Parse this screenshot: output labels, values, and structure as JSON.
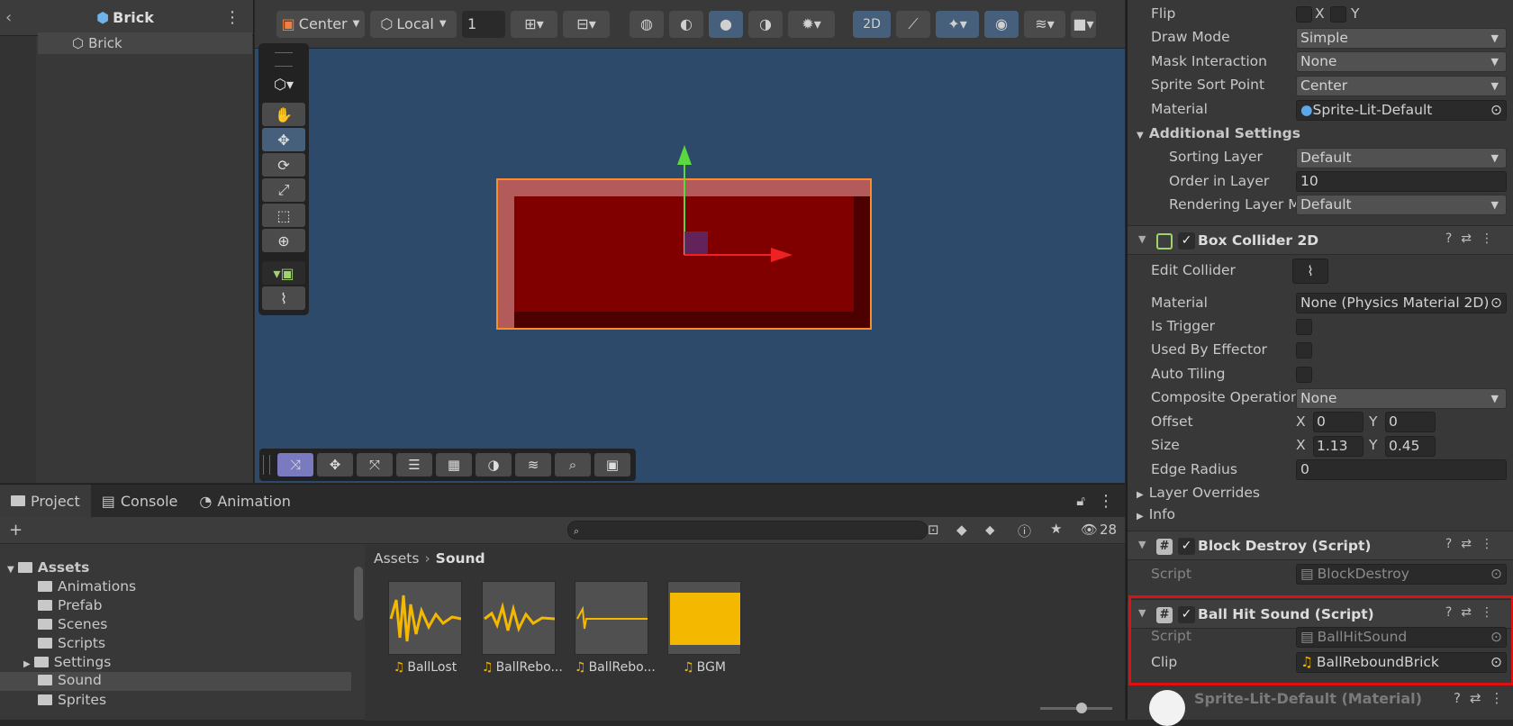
{
  "hierarchy": {
    "title": "Brick",
    "items": [
      {
        "label": "Brick"
      }
    ]
  },
  "scene_toolbar": {
    "pivot": "Center",
    "space": "Local",
    "grid_value": "1",
    "mode_2d": "2D"
  },
  "inspector": {
    "sprite": {
      "flip_label": "Flip",
      "flip_x": "X",
      "flip_y": "Y",
      "draw_mode_label": "Draw Mode",
      "draw_mode": "Simple",
      "mask_label": "Mask Interaction",
      "mask": "None",
      "sort_point_label": "Sprite Sort Point",
      "sort_point": "Center",
      "material_label": "Material",
      "material": "Sprite-Lit-Default",
      "additional_label": "Additional Settings",
      "sorting_layer_label": "Sorting Layer",
      "sorting_layer": "Default",
      "order_label": "Order in Layer",
      "order": "10",
      "rendering_layer_label": "Rendering Layer M",
      "rendering_layer": "Default"
    },
    "box_collider": {
      "title": "Box Collider 2D",
      "edit_label": "Edit Collider",
      "material_label": "Material",
      "material": "None (Physics Material 2D)",
      "trigger_label": "Is Trigger",
      "effector_label": "Used By Effector",
      "tiling_label": "Auto Tiling",
      "composite_label": "Composite Operation",
      "composite": "None",
      "offset_label": "Offset",
      "offset_x_label": "X",
      "offset_x": "0",
      "offset_y_label": "Y",
      "offset_y": "0",
      "size_label": "Size",
      "size_x_label": "X",
      "size_x": "1.13",
      "size_y_label": "Y",
      "size_y": "0.45",
      "edge_label": "Edge Radius",
      "edge": "0",
      "overrides_label": "Layer Overrides",
      "info_label": "Info"
    },
    "block_destroy": {
      "title": "Block Destroy (Script)",
      "script_label": "Script",
      "script": "BlockDestroy"
    },
    "ball_hit": {
      "title": "Ball Hit Sound (Script)",
      "script_label": "Script",
      "script": "BallHitSound",
      "clip_label": "Clip",
      "clip": "BallReboundBrick"
    },
    "material_footer": "Sprite-Lit-Default (Material)"
  },
  "project": {
    "tabs": [
      "Project",
      "Console",
      "Animation"
    ],
    "hidden_count": "28",
    "breadcrumb": [
      "Assets",
      "Sound"
    ],
    "tree": [
      "Assets",
      "Animations",
      "Prefab",
      "Scenes",
      "Scripts",
      "Settings",
      "Sound",
      "Sprites"
    ],
    "assets": [
      "BallLost",
      "BallRebo...",
      "BallRebo...",
      "BGM"
    ]
  },
  "colors": {
    "scene_bg": "#2e4a6b",
    "brick": "#800000",
    "selection_outline": "#ff8a2a",
    "highlight_box": "#e01010",
    "audio_wave": "#f5b800"
  }
}
